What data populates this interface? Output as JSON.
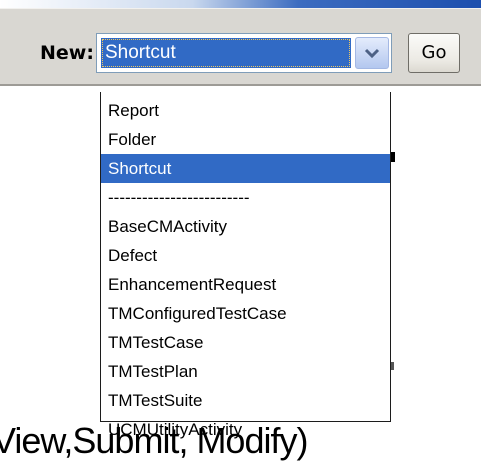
{
  "toolbar": {
    "new_label": "New:",
    "selected_value": "Shortcut",
    "go_label": "Go"
  },
  "dropdown": {
    "options": [
      "Report",
      "Folder",
      "Shortcut",
      "-------------------------",
      "BaseCMActivity",
      "Defect",
      "EnhancementRequest",
      "TMConfiguredTestCase",
      "TMTestCase",
      "TMTestPlan",
      "TMTestSuite",
      "UCMUtilityActivity"
    ],
    "selected_index": 2
  },
  "background": {
    "text": "View,Submit, Modify)"
  },
  "colors": {
    "selection": "#316ac5",
    "toolbar_bg": "#d9d7d2"
  },
  "icons": {
    "combo_arrow": "chevron-down-icon"
  }
}
